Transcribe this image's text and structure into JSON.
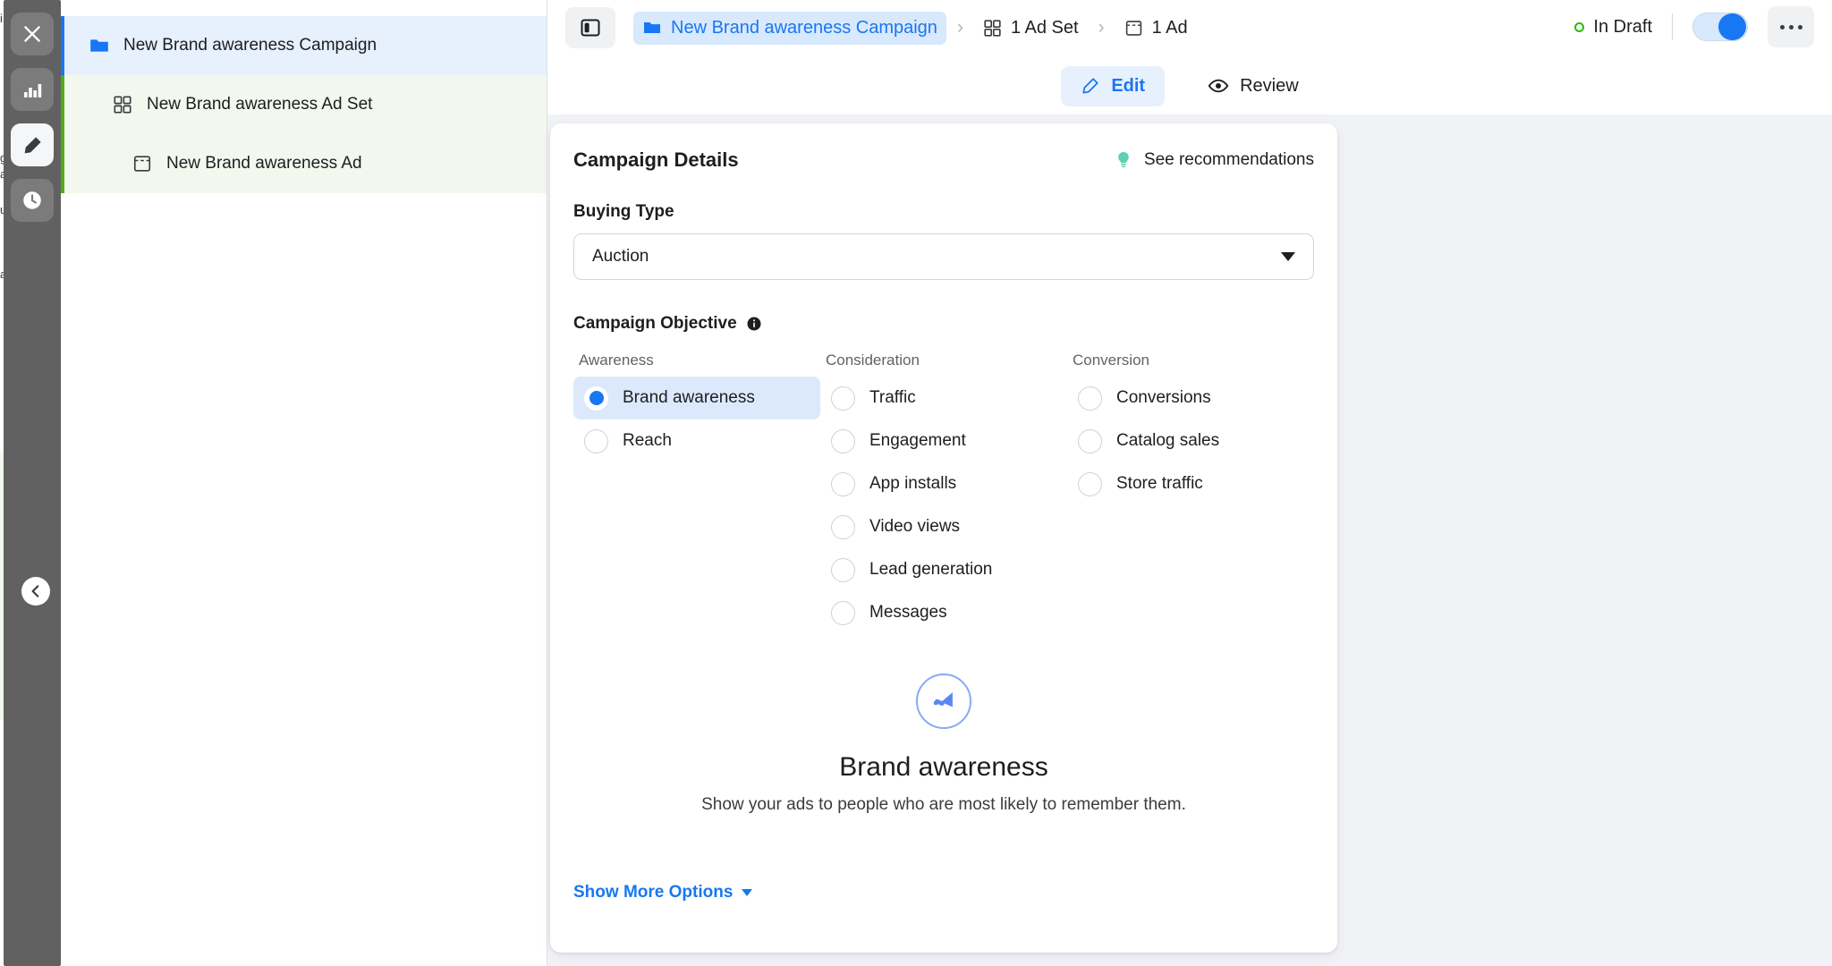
{
  "dock": {
    "buttons": [
      {
        "name": "close-icon",
        "label": "Close"
      },
      {
        "name": "analytics-icon",
        "label": "Analytics"
      },
      {
        "name": "edit-pencil-icon",
        "label": "Edit",
        "active": true
      },
      {
        "name": "history-clock-icon",
        "label": "History"
      }
    ],
    "collapse_label": "Collapse"
  },
  "underlay": {
    "lines": [
      "i",
      "g",
      "a",
      "u",
      "a"
    ]
  },
  "tree": {
    "items": [
      {
        "label": "New Brand awareness Campaign",
        "icon": "folder-icon",
        "level": 0,
        "state": "campaign"
      },
      {
        "label": "New Brand awareness Ad Set",
        "icon": "grid-icon",
        "level": 1,
        "state": "adset"
      },
      {
        "label": "New Brand awareness Ad",
        "icon": "ad-icon",
        "level": 2,
        "state": "ad"
      }
    ]
  },
  "header": {
    "panel_toggle": "sidebar-toggle",
    "breadcrumb": [
      {
        "label": "New Brand awareness Campaign",
        "icon": "folder-icon",
        "current": true
      },
      {
        "label": "1 Ad Set",
        "icon": "grid-icon",
        "current": false
      },
      {
        "label": "1 Ad",
        "icon": "ad-icon",
        "current": false
      }
    ],
    "separator": "›",
    "status": "In Draft",
    "status_color": "#21c000",
    "toggle_on": true,
    "menu_label": "More options"
  },
  "tabs": [
    {
      "label": "Edit",
      "icon": "pencil-icon",
      "active": true
    },
    {
      "label": "Review",
      "icon": "eye-icon",
      "active": false
    }
  ],
  "card": {
    "title": "Campaign Details",
    "recommendations_label": "See recommendations",
    "buying_type_label": "Buying Type",
    "buying_type_value": "Auction",
    "objective_label": "Campaign Objective",
    "columns": [
      {
        "heading": "Awareness",
        "options": [
          {
            "label": "Brand awareness",
            "selected": true
          },
          {
            "label": "Reach",
            "selected": false
          }
        ]
      },
      {
        "heading": "Consideration",
        "options": [
          {
            "label": "Traffic",
            "selected": false
          },
          {
            "label": "Engagement",
            "selected": false
          },
          {
            "label": "App installs",
            "selected": false
          },
          {
            "label": "Video views",
            "selected": false
          },
          {
            "label": "Lead generation",
            "selected": false
          },
          {
            "label": "Messages",
            "selected": false
          }
        ]
      },
      {
        "heading": "Conversion",
        "options": [
          {
            "label": "Conversions",
            "selected": false
          },
          {
            "label": "Catalog sales",
            "selected": false
          },
          {
            "label": "Store traffic",
            "selected": false
          }
        ]
      }
    ],
    "hero_title": "Brand awareness",
    "hero_subtitle": "Show your ads to people who are most likely to remember them.",
    "show_more_label": "Show More Options"
  },
  "colors": {
    "accent_blue": "#1877f2",
    "accent_green": "#4caf17",
    "status_green": "#21c000",
    "teal_bulb": "#5ed0b4"
  }
}
